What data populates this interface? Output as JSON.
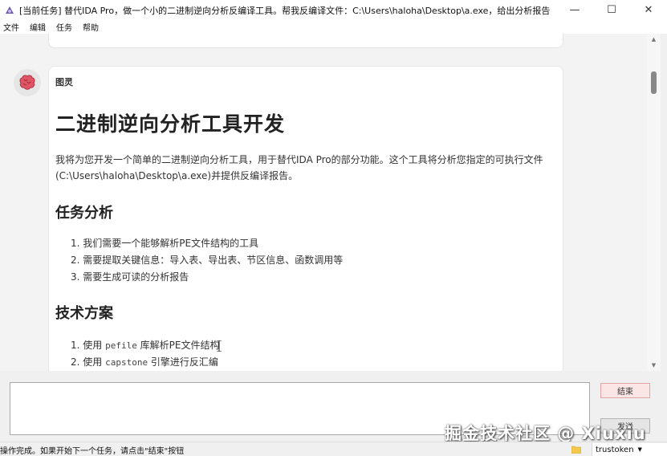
{
  "window": {
    "title": "[当前任务] 替代IDA Pro，做一个小的二进制逆向分析反编译工具。帮我反编译文件：C:\\Users\\haloha\\Desktop\\a.exe，给出分析报告",
    "minimize": "—",
    "maximize": "☐",
    "close": "✕"
  },
  "menu": [
    "文件",
    "编辑",
    "任务",
    "帮助"
  ],
  "message": {
    "sender": "图灵",
    "h1": "二进制逆向分析工具开发",
    "intro": "我将为您开发一个简单的二进制逆向分析工具，用于替代IDA Pro的部分功能。这个工具将分析您指定的可执行文件(C:\\Users\\haloha\\Desktop\\a.exe)并提供反编译报告。",
    "section1": {
      "title": "任务分析",
      "items": [
        "1. 我们需要一个能够解析PE文件结构的工具",
        "2. 需要提取关键信息：导入表、导出表、节区信息、函数调用等",
        "3. 需要生成可读的分析报告"
      ]
    },
    "section2": {
      "title": "技术方案",
      "items": [
        {
          "prefix": "1. 使用 ",
          "code": "pefile",
          "suffix": " 库解析PE文件结构"
        },
        {
          "prefix": "2. 使用 ",
          "code": "capstone",
          "suffix": " 引擎进行反汇编"
        }
      ]
    }
  },
  "input": {
    "value": "",
    "end_label": "结束",
    "send_label": "发送"
  },
  "watermark": "掘金技术社区 @ Xiuxiu",
  "status": {
    "text": "操作完成。如果开始下一个任务，请点击\"结束\"按钮",
    "token": "trustoken"
  },
  "colors": {
    "end_button_bg": "#fbe5e5",
    "avatar_brain": "#e05565"
  }
}
